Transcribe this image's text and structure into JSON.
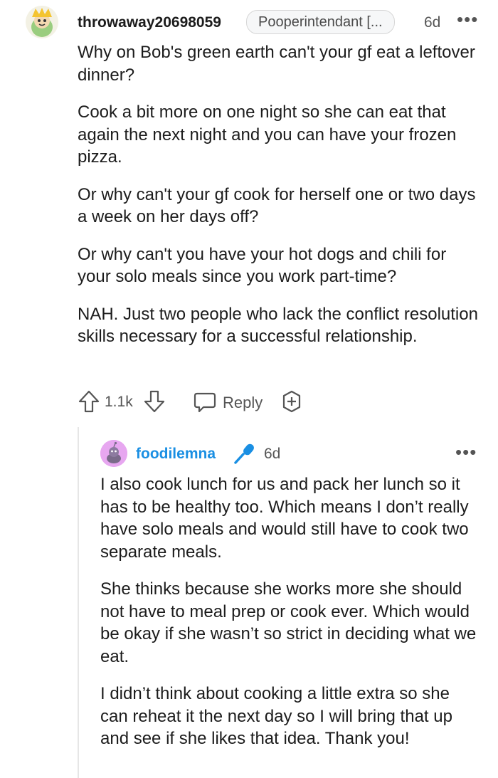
{
  "top_comment": {
    "username": "throwaway20698059",
    "flair": "Pooperintendant [...",
    "time": "6d",
    "more": "•••",
    "paragraphs": [
      "Why on Bob's green earth can't your gf eat a leftover dinner?",
      "Cook a bit more on one night so she can eat that again the next night and you can have your frozen pizza.",
      "Or why can't your gf cook for herself one or two days a week on her days off?",
      "Or why can't you have your hot dogs and chili for your solo meals since you work part-time?",
      "NAH. Just two people who lack the conflict resolution skills necessary for a successful relationship."
    ],
    "score": "1.1k",
    "reply_label": "Reply",
    "icons": {
      "upvote": "upvote-icon",
      "downvote": "downvote-icon",
      "reply": "speech-bubble-icon",
      "award": "award-plus-icon"
    }
  },
  "reply_comment": {
    "username": "foodilemna",
    "time": "6d",
    "more": "•••",
    "op_badge_icon": "microphone-icon",
    "paragraphs": [
      "I also cook lunch for us and pack her lunch so it has to be healthy too. Which means I don’t really have solo meals and would still have to cook two separate meals.",
      "She thinks because she works more she should not have to meal prep or cook ever. Which would be okay if she wasn’t so strict in deciding what we eat.",
      "I didn’t think about cooking a little extra so she can reheat it the next day so I will bring that up and see if she likes that idea. Thank you!"
    ]
  },
  "colors": {
    "username_reply": "#1a8fe3",
    "mic_badge": "#1a8fe3",
    "avatar_reply_bg": "#e7a7f0",
    "muted_text": "#555555",
    "thread_line": "#e6e6e6"
  }
}
